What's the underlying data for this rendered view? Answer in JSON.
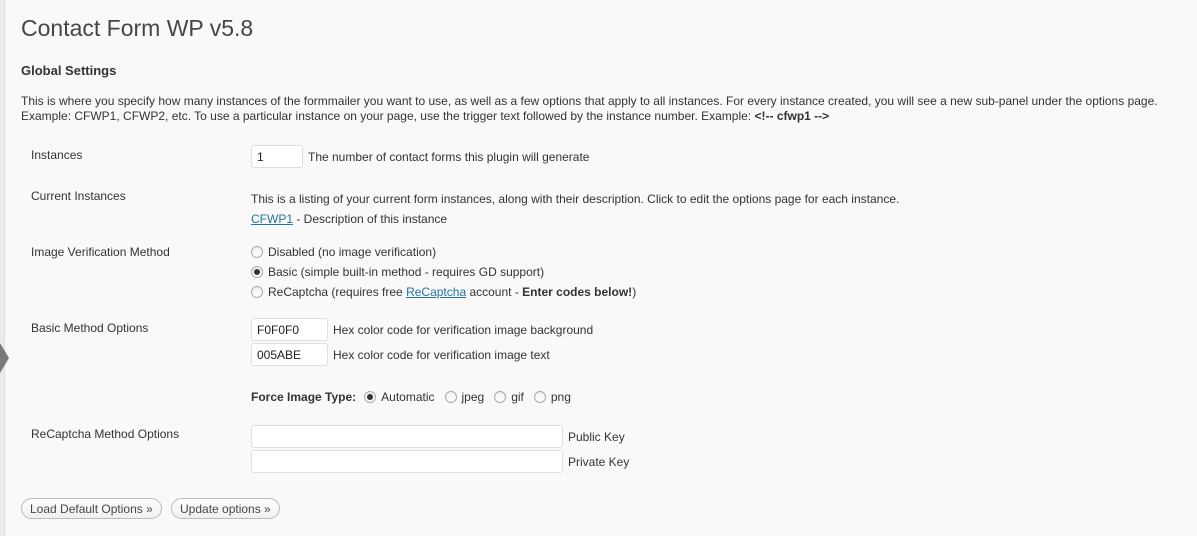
{
  "page": {
    "title": "Contact Form WP v5.8",
    "section_heading": "Global Settings",
    "intro_line1": "This is where you specify how many instances of the formmailer you want to use, as well as a few options that apply to all instances. For every instance created, you will see a new sub-panel under the options page.",
    "intro_line2_prefix": "Example: CFWP1, CFWP2, etc. To use a particular instance on your page, use the trigger text followed by the instance number. Example: ",
    "intro_line2_code": "<!-- cfwp1 -->"
  },
  "instances": {
    "label": "Instances",
    "value": "1",
    "description": "The number of contact forms this plugin will generate"
  },
  "current_instances": {
    "label": "Current Instances",
    "description": "This is a listing of your current form instances, along with their description. Click to edit the options page for each instance.",
    "link": "CFWP1",
    "link_suffix": " - Description of this instance"
  },
  "image_verification": {
    "label": "Image Verification Method",
    "options": [
      {
        "label": "Disabled (no image verification)",
        "checked": false
      },
      {
        "label": "Basic (simple built-in method - requires GD support)",
        "checked": true
      }
    ],
    "recaptcha_prefix": "ReCaptcha (requires free ",
    "recaptcha_link": "ReCaptcha",
    "recaptcha_middle": " account - ",
    "recaptcha_bold": "Enter codes below!",
    "recaptcha_suffix": ")"
  },
  "basic_options": {
    "label": "Basic Method Options",
    "bg_value": "F0F0F0",
    "bg_description": "Hex color code for verification image background",
    "text_value": "005ABE",
    "text_description": "Hex color code for verification image text",
    "force_label": "Force Image Type:",
    "force_options": [
      {
        "label": "Automatic",
        "checked": true
      },
      {
        "label": "jpeg",
        "checked": false
      },
      {
        "label": "gif",
        "checked": false
      },
      {
        "label": "png",
        "checked": false
      }
    ]
  },
  "recaptcha_options": {
    "label": "ReCaptcha Method Options",
    "public_key_value": "",
    "public_key_label": "Public Key",
    "private_key_value": "",
    "private_key_label": "Private Key"
  },
  "buttons": {
    "load_default": "Load Default Options »",
    "update": "Update options »"
  },
  "colors": {
    "link": "#21759b",
    "title": "#464646",
    "background": "#f9f9f9"
  }
}
